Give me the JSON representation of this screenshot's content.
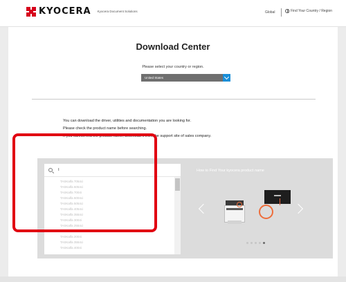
{
  "header": {
    "brand": "KYOCERA",
    "brand_sub": "Kyocera Document Solutions",
    "global_label": "Global",
    "region_label": "Find Your Country / Region",
    "colors": {
      "brand_red": "#d7001c"
    }
  },
  "main": {
    "title": "Download Center",
    "country_prompt": "Please select your country or region.",
    "country_select": {
      "selected": "United States"
    },
    "intro_lines": [
      "You can download the driver, utilities and documentation you are looking for.",
      "Please check the product name before searching.",
      "If you cannot find the product name, download it from the support site of sales company."
    ]
  },
  "search": {
    "query": "T",
    "results": [
      "TASKalfa 7054ci",
      "TASKalfa 6054ci",
      "TASKalfa 7004i",
      "TASKalfa 6004ci",
      "TASKalfa 5054ci",
      "TASKalfa 4054ci",
      "TASKalfa 3554ci",
      "TASKalfa 3004i",
      "TASKalfa 2554ci",
      "TASKalfa 3004i",
      "TASKalfa 2004i",
      "TASKalfa 3554ci",
      "TASKalfa 4004i"
    ],
    "highlight_color": "#e10011"
  },
  "howto": {
    "title": "How to Find Your kyocera product name",
    "carousel": {
      "slides": 5,
      "active_index": 4
    }
  }
}
